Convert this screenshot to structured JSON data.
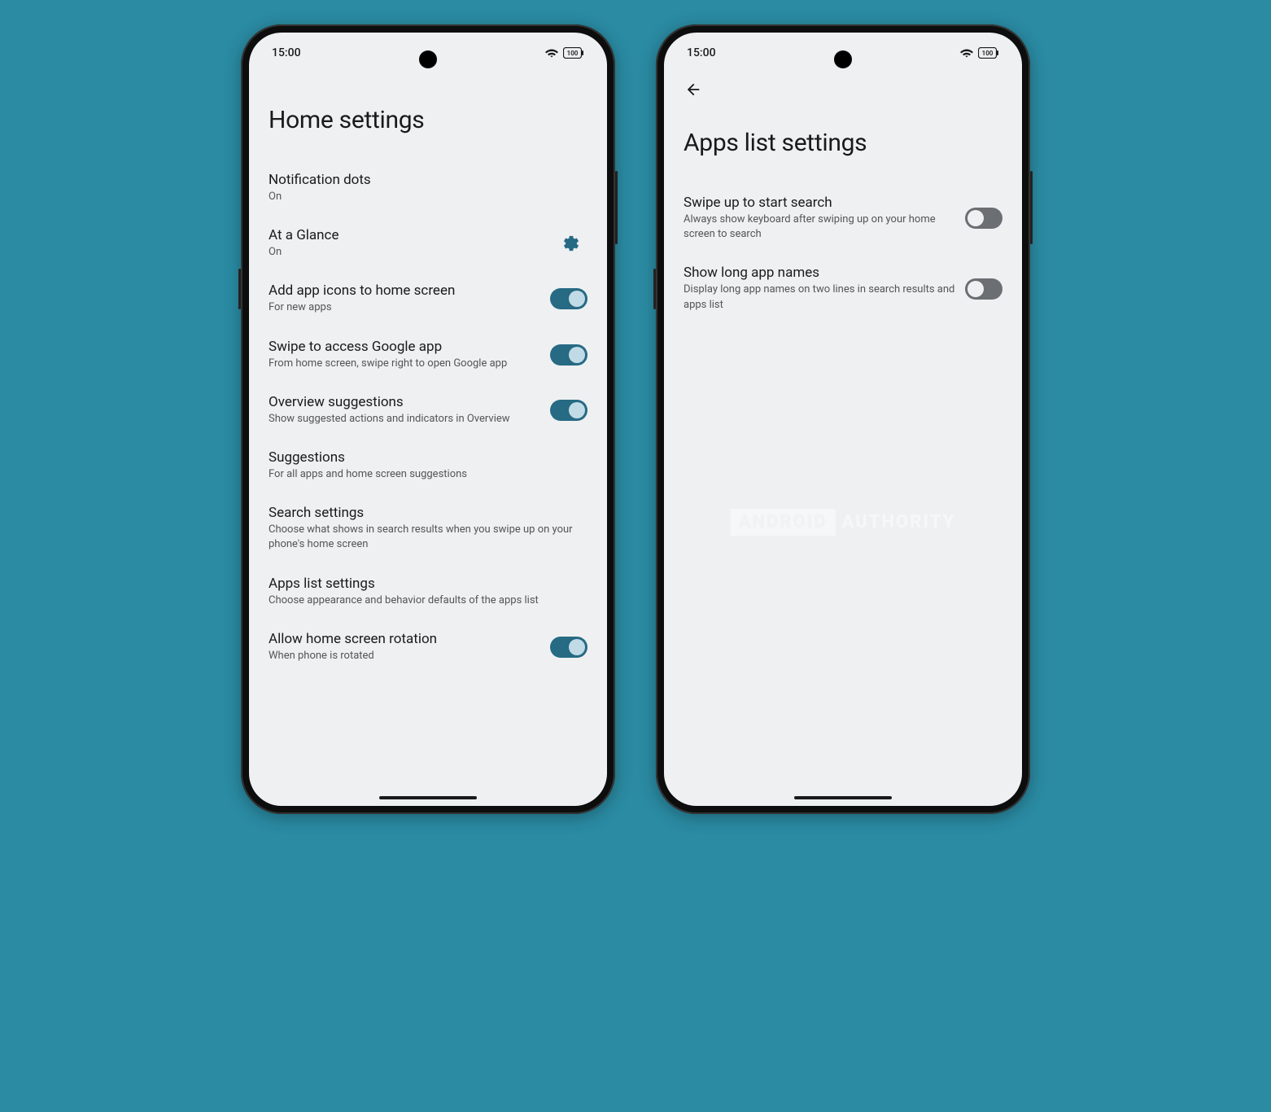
{
  "status": {
    "time": "15:00",
    "battery": "100"
  },
  "left_phone": {
    "title": "Home settings",
    "items": [
      {
        "title": "Notification dots",
        "sub": "On",
        "action": "none"
      },
      {
        "title": "At a Glance",
        "sub": "On",
        "action": "gear"
      },
      {
        "title": "Add app icons to home screen",
        "sub": "For new apps",
        "action": "toggle",
        "toggled": true
      },
      {
        "title": "Swipe to access Google app",
        "sub": "From home screen, swipe right to open Google app",
        "action": "toggle",
        "toggled": true
      },
      {
        "title": "Overview suggestions",
        "sub": "Show suggested actions and indicators in Overview",
        "action": "toggle",
        "toggled": true
      },
      {
        "title": "Suggestions",
        "sub": "For all apps and home screen suggestions",
        "action": "none"
      },
      {
        "title": "Search settings",
        "sub": "Choose what shows in search results when you swipe up on your phone's home screen",
        "action": "none"
      },
      {
        "title": "Apps list settings",
        "sub": "Choose appearance and behavior defaults of the apps list",
        "action": "none"
      },
      {
        "title": "Allow home screen rotation",
        "sub": "When phone is rotated",
        "action": "toggle",
        "toggled": true
      }
    ]
  },
  "right_phone": {
    "title": "Apps list settings",
    "has_back": true,
    "items": [
      {
        "title": "Swipe up to start search",
        "sub": "Always show keyboard after swiping up on your home screen to search",
        "action": "toggle",
        "toggled": false
      },
      {
        "title": "Show long app names",
        "sub": "Display long app names on two lines in search results and apps list",
        "action": "toggle",
        "toggled": false
      }
    ]
  },
  "watermark": {
    "brand1": "ANDROID",
    "brand2": "AUTHORITY"
  },
  "colors": {
    "background": "#2a8ba3",
    "screen": "#eef0f2",
    "toggle_on": "#266a84",
    "toggle_off": "#6b6e72",
    "accent": "#266a84"
  }
}
